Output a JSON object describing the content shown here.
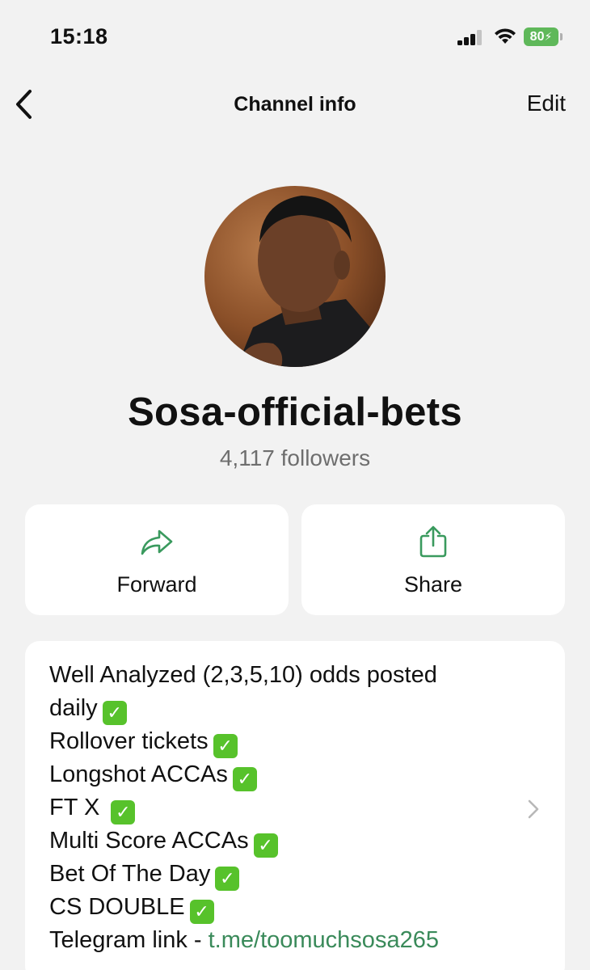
{
  "status_bar": {
    "time": "15:18",
    "battery": "80",
    "icons": [
      "cellular-signal-icon",
      "wifi-icon",
      "battery-charging-icon"
    ]
  },
  "nav": {
    "title": "Channel info",
    "edit_label": "Edit",
    "back_icon": "chevron-left-icon"
  },
  "channel": {
    "name": "Sosa-official-bets",
    "followers": "4,117 followers"
  },
  "actions": [
    {
      "label": "Forward",
      "icon": "forward-arrow-icon"
    },
    {
      "label": "Share",
      "icon": "share-icon"
    }
  ],
  "description": {
    "lines": [
      "Well Analyzed (2,3,5,10) odds posted",
      "daily",
      "Rollover tickets",
      "Longshot ACCAs",
      "FT X",
      "Multi Score ACCAs",
      "Bet Of The Day",
      "CS DOUBLE"
    ],
    "check_mark": "✓",
    "telegram_prefix": "Telegram link - ",
    "telegram_link": "t.me/toomuchsosa265"
  },
  "colors": {
    "background": "#f2f2f2",
    "accent_green": "#3a8a5a",
    "battery_green": "#5fb85a",
    "check_green": "#57c22b"
  }
}
